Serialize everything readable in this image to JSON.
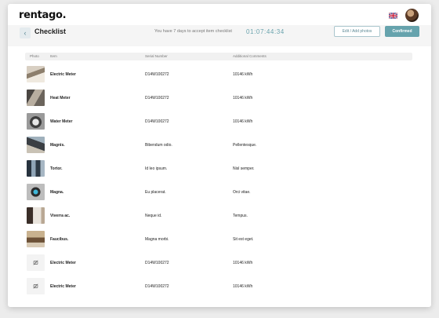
{
  "app": {
    "logo": "rentago."
  },
  "header": {
    "title": "Checklist",
    "accept_message": "You have 7 days to accept item checklist",
    "timer": "01:07:44:34",
    "edit_button": "Edit / Add photos",
    "confirm_button": "Confirmed"
  },
  "icons": {
    "language": "uk-flag-icon",
    "back": "chevron-left-icon",
    "placeholder": "no-image-icon"
  },
  "colors": {
    "accent": "#66a3ad",
    "accent_text": "#5f8a96"
  },
  "table": {
    "columns": [
      "Photo",
      "Item",
      "Serial Number",
      "Additional Comments"
    ],
    "rows": [
      {
        "item": "Electric Meter",
        "serial": "D14W100272",
        "comment": "10146 kWh",
        "photo": "photo"
      },
      {
        "item": "Heat Meter",
        "serial": "D14W100272",
        "comment": "10146 kWh",
        "photo": "photo"
      },
      {
        "item": "Water Meter",
        "serial": "D14W100272",
        "comment": "10146 kWh",
        "photo": "photo"
      },
      {
        "item": "Magnis.",
        "serial": "Bibendum odio.",
        "comment": "Pellentesque.",
        "photo": "photo"
      },
      {
        "item": "Tortor.",
        "serial": "Id leo ipsum.",
        "comment": "Nisl semper.",
        "photo": "photo"
      },
      {
        "item": "Magna.",
        "serial": "Eu placerat.",
        "comment": "Orci vitae.",
        "photo": "photo"
      },
      {
        "item": "Viverra ac.",
        "serial": "Neque id.",
        "comment": "Tempus.",
        "photo": "photo"
      },
      {
        "item": "Faucibus.",
        "serial": "Magna morbi.",
        "comment": "Sit est eget.",
        "photo": "photo"
      },
      {
        "item": "Electric Meter",
        "serial": "D14W100272",
        "comment": "10146 kWh",
        "photo": "placeholder"
      },
      {
        "item": "Electric Meter",
        "serial": "D14W100272",
        "comment": "10146 kWh",
        "photo": "placeholder"
      }
    ]
  }
}
